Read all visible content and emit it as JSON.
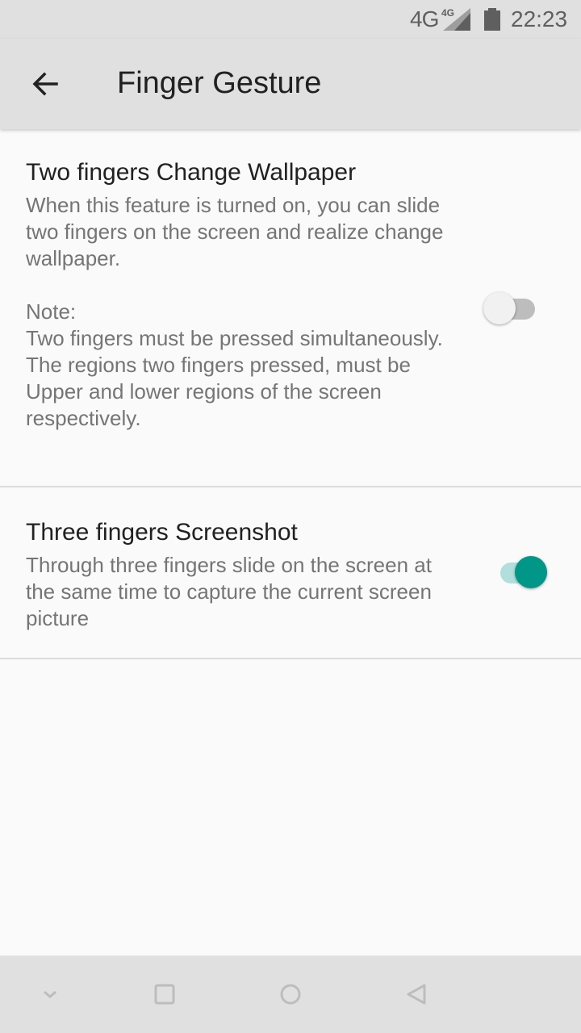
{
  "status_bar": {
    "network": "4G",
    "network_badge": "4G",
    "time": "22:23"
  },
  "toolbar": {
    "title": "Finger Gesture",
    "back_icon": "arrow-back-icon"
  },
  "settings": [
    {
      "title": "Two fingers Change Wallpaper",
      "description": "When this feature is turned on, you can slide two fingers on the screen and realize change wallpaper.\n\nNote:\nTwo fingers must be pressed simultaneously.\nThe regions two fingers pressed, must be Upper and lower regions of the screen respectively.",
      "enabled": false
    },
    {
      "title": "Three fingers Screenshot",
      "description": "Through three fingers slide on the screen at the same time to capture the current screen picture",
      "enabled": true
    }
  ],
  "nav_bar": {
    "icons": [
      "chevron-down-icon",
      "square-icon",
      "circle-icon",
      "triangle-back-icon"
    ]
  },
  "colors": {
    "accent": "#009688",
    "accent_track": "#b2dfdb",
    "bar_background": "#e0e0e0",
    "page_background": "#fafafa"
  }
}
